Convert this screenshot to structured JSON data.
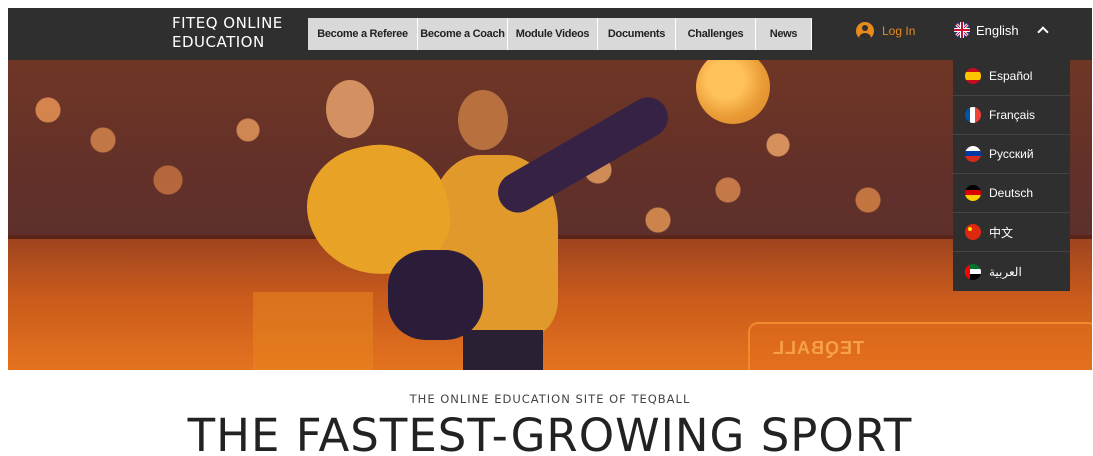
{
  "brand": {
    "line1": "FITEQ ONLINE",
    "line2": "EDUCATION"
  },
  "nav": {
    "items": [
      {
        "label": "Become a Referee"
      },
      {
        "label": "Become a Coach"
      },
      {
        "label": "Module Videos"
      },
      {
        "label": "Documents"
      },
      {
        "label": "Challenges"
      },
      {
        "label": "News"
      }
    ]
  },
  "login": {
    "label": "Log In",
    "icon": "user-icon"
  },
  "language": {
    "selected": "English",
    "expanded": true,
    "options": [
      {
        "label": "Español",
        "flag": "spain-flag-icon"
      },
      {
        "label": "Français",
        "flag": "france-flag-icon"
      },
      {
        "label": "Русский",
        "flag": "russia-flag-icon"
      },
      {
        "label": "Deutsch",
        "flag": "germany-flag-icon"
      },
      {
        "label": "中文",
        "flag": "china-flag-icon"
      },
      {
        "label": "العربية",
        "flag": "uae-flag-icon"
      }
    ]
  },
  "hero": {
    "board_text": "TEQBALL"
  },
  "content": {
    "eyebrow": "THE ONLINE EDUCATION SITE OF TEQBALL",
    "headline": "THE FASTEST-GROWING SPORT"
  },
  "colors": {
    "header_bg": "#2f2f2f",
    "accent": "#e88a1c",
    "nav_bg": "#d9d9d9"
  }
}
